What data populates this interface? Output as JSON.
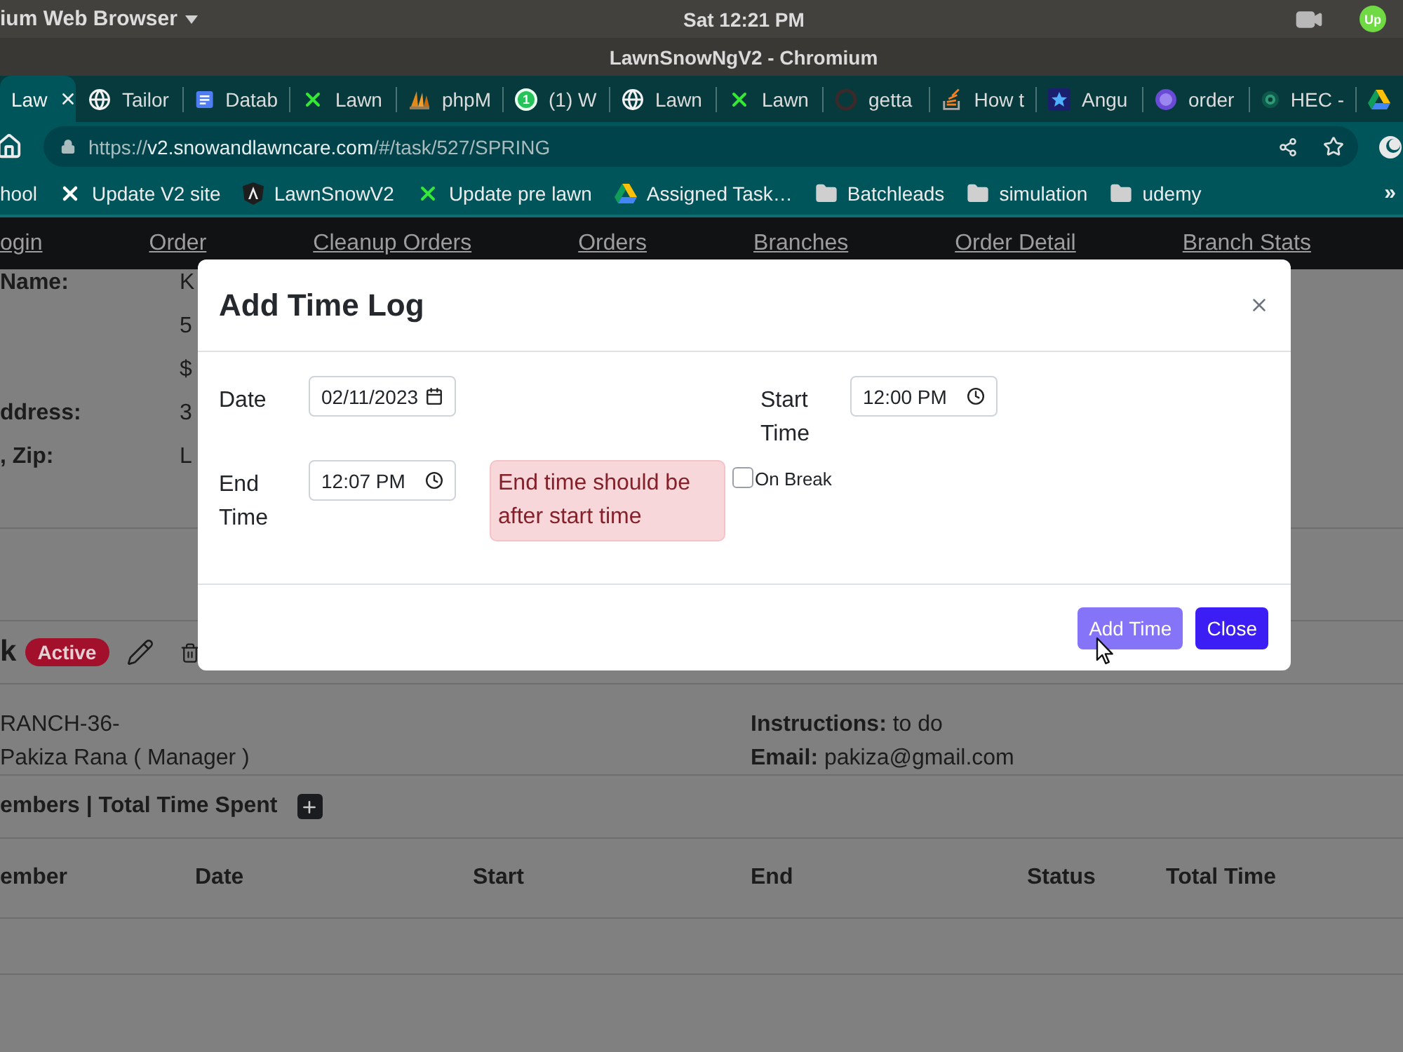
{
  "system_bar": {
    "app_menu": "ium Web Browser",
    "clock": "Sat 12:21 PM",
    "tray_badge": "Up"
  },
  "window": {
    "title": "LawnSnowNgV2 - Chromium"
  },
  "tabs": [
    {
      "title": "Law",
      "selected": true,
      "kind": "none"
    },
    {
      "title": "Tailor",
      "selected": false,
      "kind": "globe"
    },
    {
      "title": "Datab",
      "selected": false,
      "kind": "doc"
    },
    {
      "title": "Lawn",
      "selected": false,
      "kind": "cross"
    },
    {
      "title": "phpM",
      "selected": false,
      "kind": "sails"
    },
    {
      "title": "(1) W",
      "selected": false,
      "kind": "chat",
      "badge": "1"
    },
    {
      "title": "Lawn",
      "selected": false,
      "kind": "globe"
    },
    {
      "title": "Lawn",
      "selected": false,
      "kind": "cross"
    },
    {
      "title": "getta",
      "selected": false,
      "kind": "ring"
    },
    {
      "title": "How t",
      "selected": false,
      "kind": "stack"
    },
    {
      "title": "Angu",
      "selected": false,
      "kind": "star"
    },
    {
      "title": "order",
      "selected": false,
      "kind": "orb"
    },
    {
      "title": "HEC -",
      "selected": false,
      "kind": "emblem"
    },
    {
      "selected": false,
      "kind": "drive"
    }
  ],
  "address_bar": {
    "url": {
      "scheme": "https://",
      "host": "v2.snowandlawncare.com",
      "path": "/#/task/527/SPRING"
    }
  },
  "bookmarks": {
    "items": [
      {
        "title": "hool",
        "kind": "none"
      },
      {
        "title": "Update V2 site",
        "kind": "xmark"
      },
      {
        "title": "LawnSnowV2",
        "kind": "shield"
      },
      {
        "title": "Update pre lawn",
        "kind": "cross"
      },
      {
        "title": "Assigned Task…",
        "kind": "drive"
      },
      {
        "title": "Batchleads",
        "kind": "folder"
      },
      {
        "title": "simulation",
        "kind": "folder"
      },
      {
        "title": "udemy",
        "kind": "folder"
      }
    ],
    "overflow": "»"
  },
  "nav": [
    "ogin",
    "Order",
    "Cleanup Orders",
    "Orders",
    "Branches",
    "Order Detail",
    "Branch Stats"
  ],
  "details": [
    {
      "label": "Name:",
      "value": "K"
    },
    {
      "value": "5"
    },
    {
      "value": "$"
    },
    {
      "label": "ddress:",
      "value": "3"
    },
    {
      "label": ", Zip:",
      "value": "L"
    }
  ],
  "task": {
    "title": "k",
    "status": "Active"
  },
  "assignment": {
    "lines": [
      "RANCH-36-",
      "Pakiza Rana ( Manager )"
    ],
    "notes": [
      "**Instructions:** to do",
      "**Email:** pakiza@gmail.com"
    ]
  },
  "members": {
    "title": "embers | Total Time Spent"
  },
  "table": {
    "columns": [
      "ember",
      "Date",
      "Start",
      "End",
      "Status",
      "Total Time"
    ]
  },
  "modal": {
    "title": "Add Time Log",
    "fields": [
      {
        "label": "Date",
        "value": "02/11/2023",
        "kind": "date"
      },
      {
        "label": "Start Time",
        "value": "12:00 PM",
        "kind": "time"
      },
      {
        "label": "End Time",
        "value": "12:07 PM",
        "kind": "time"
      }
    ],
    "error": "End time should be after start time",
    "on_break": {
      "label": "On Break",
      "checked": false
    },
    "buttons": [
      {
        "label": "Add Time",
        "disabled": true
      },
      {
        "label": "Close",
        "disabled": false
      }
    ]
  }
}
